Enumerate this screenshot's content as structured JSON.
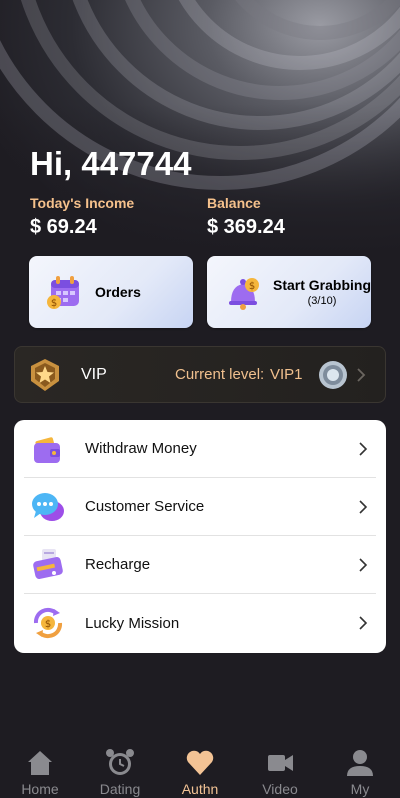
{
  "header": {
    "greeting": "Hi, 447744",
    "today_income_label": "Today's Income",
    "today_income_value": "$ 69.24",
    "balance_label": "Balance",
    "balance_value": "$ 369.24"
  },
  "actions": {
    "orders_label": "Orders",
    "grab_label": "Start Grabbing",
    "grab_progress": "(3/10)"
  },
  "vip": {
    "label": "VIP",
    "current_level_label": "Current level:",
    "current_level_value": "VIP1"
  },
  "menu": {
    "items": [
      {
        "label": "Withdraw Money",
        "icon": "wallet-icon"
      },
      {
        "label": "Customer Service",
        "icon": "chat-bubbles-icon"
      },
      {
        "label": "Recharge",
        "icon": "card-terminal-icon"
      },
      {
        "label": "Lucky Mission",
        "icon": "coin-cycle-icon"
      }
    ]
  },
  "tabbar": {
    "items": [
      {
        "label": "Home",
        "icon": "home-icon"
      },
      {
        "label": "Dating",
        "icon": "alarm-clock-icon"
      },
      {
        "label": "Authn",
        "icon": "heart-icon",
        "active": true
      },
      {
        "label": "Video",
        "icon": "video-camera-icon"
      },
      {
        "label": "My",
        "icon": "person-icon"
      }
    ]
  },
  "colors": {
    "accent": "#f3c395",
    "income_label": "#f5c18c",
    "background": "#1e1c22"
  }
}
